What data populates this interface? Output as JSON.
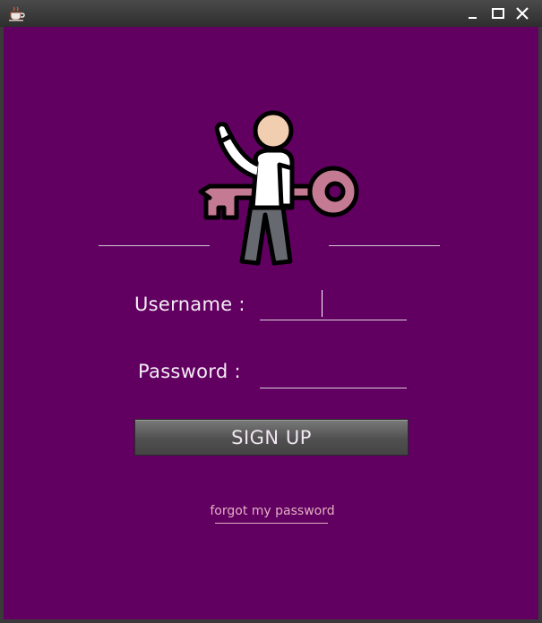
{
  "window": {
    "title": "",
    "icons": {
      "app": "coffee-cup-icon",
      "minimize": "minimize-icon",
      "maximize": "maximize-icon",
      "close": "close-icon"
    }
  },
  "hero": {
    "icon": "person-with-key-icon"
  },
  "form": {
    "username_label": "Username  :",
    "username_value": "",
    "password_label": "Password  :",
    "password_value": "",
    "submit_label": "SIGN UP"
  },
  "links": {
    "forgot_password": "forgot my password"
  },
  "colors": {
    "background": "#620062",
    "button": "#555555",
    "key": "#c47a93",
    "link": "#e0b0c0"
  }
}
